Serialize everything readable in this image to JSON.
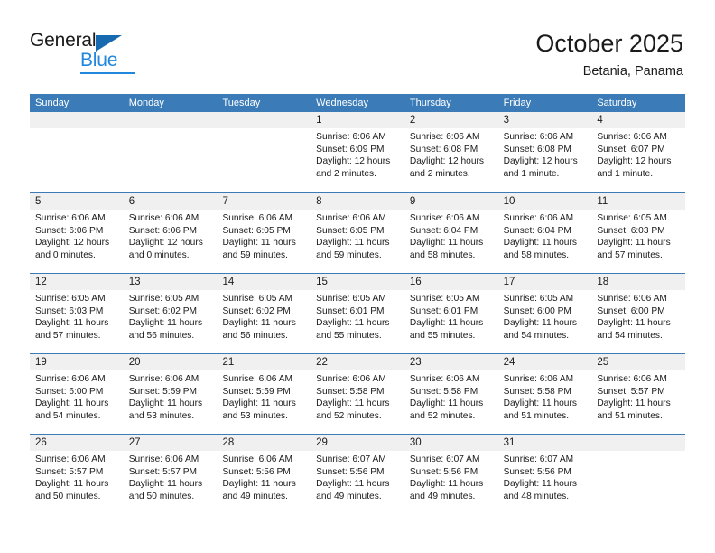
{
  "brand": {
    "name_top": "General",
    "name_bottom": "Blue",
    "color_primary": "#2288dd",
    "color_triangle": "#1769b0"
  },
  "header": {
    "title": "October 2025",
    "subtitle": "Betania, Panama"
  },
  "theme": {
    "header_row_bg": "#3b7cb8",
    "daynum_band_bg": "#f0f0f0",
    "cell_bg": "#ffffff",
    "text": "#1a1a1a"
  },
  "calendar": {
    "weekday_headers": [
      "Sunday",
      "Monday",
      "Tuesday",
      "Wednesday",
      "Thursday",
      "Friday",
      "Saturday"
    ],
    "weeks": [
      [
        {
          "day": "",
          "empty": true
        },
        {
          "day": "",
          "empty": true
        },
        {
          "day": "",
          "empty": true
        },
        {
          "day": "1",
          "sunrise": "Sunrise: 6:06 AM",
          "sunset": "Sunset: 6:09 PM",
          "daylight": "Daylight: 12 hours and 2 minutes."
        },
        {
          "day": "2",
          "sunrise": "Sunrise: 6:06 AM",
          "sunset": "Sunset: 6:08 PM",
          "daylight": "Daylight: 12 hours and 2 minutes."
        },
        {
          "day": "3",
          "sunrise": "Sunrise: 6:06 AM",
          "sunset": "Sunset: 6:08 PM",
          "daylight": "Daylight: 12 hours and 1 minute."
        },
        {
          "day": "4",
          "sunrise": "Sunrise: 6:06 AM",
          "sunset": "Sunset: 6:07 PM",
          "daylight": "Daylight: 12 hours and 1 minute."
        }
      ],
      [
        {
          "day": "5",
          "sunrise": "Sunrise: 6:06 AM",
          "sunset": "Sunset: 6:06 PM",
          "daylight": "Daylight: 12 hours and 0 minutes."
        },
        {
          "day": "6",
          "sunrise": "Sunrise: 6:06 AM",
          "sunset": "Sunset: 6:06 PM",
          "daylight": "Daylight: 12 hours and 0 minutes."
        },
        {
          "day": "7",
          "sunrise": "Sunrise: 6:06 AM",
          "sunset": "Sunset: 6:05 PM",
          "daylight": "Daylight: 11 hours and 59 minutes."
        },
        {
          "day": "8",
          "sunrise": "Sunrise: 6:06 AM",
          "sunset": "Sunset: 6:05 PM",
          "daylight": "Daylight: 11 hours and 59 minutes."
        },
        {
          "day": "9",
          "sunrise": "Sunrise: 6:06 AM",
          "sunset": "Sunset: 6:04 PM",
          "daylight": "Daylight: 11 hours and 58 minutes."
        },
        {
          "day": "10",
          "sunrise": "Sunrise: 6:06 AM",
          "sunset": "Sunset: 6:04 PM",
          "daylight": "Daylight: 11 hours and 58 minutes."
        },
        {
          "day": "11",
          "sunrise": "Sunrise: 6:05 AM",
          "sunset": "Sunset: 6:03 PM",
          "daylight": "Daylight: 11 hours and 57 minutes."
        }
      ],
      [
        {
          "day": "12",
          "sunrise": "Sunrise: 6:05 AM",
          "sunset": "Sunset: 6:03 PM",
          "daylight": "Daylight: 11 hours and 57 minutes."
        },
        {
          "day": "13",
          "sunrise": "Sunrise: 6:05 AM",
          "sunset": "Sunset: 6:02 PM",
          "daylight": "Daylight: 11 hours and 56 minutes."
        },
        {
          "day": "14",
          "sunrise": "Sunrise: 6:05 AM",
          "sunset": "Sunset: 6:02 PM",
          "daylight": "Daylight: 11 hours and 56 minutes."
        },
        {
          "day": "15",
          "sunrise": "Sunrise: 6:05 AM",
          "sunset": "Sunset: 6:01 PM",
          "daylight": "Daylight: 11 hours and 55 minutes."
        },
        {
          "day": "16",
          "sunrise": "Sunrise: 6:05 AM",
          "sunset": "Sunset: 6:01 PM",
          "daylight": "Daylight: 11 hours and 55 minutes."
        },
        {
          "day": "17",
          "sunrise": "Sunrise: 6:05 AM",
          "sunset": "Sunset: 6:00 PM",
          "daylight": "Daylight: 11 hours and 54 minutes."
        },
        {
          "day": "18",
          "sunrise": "Sunrise: 6:06 AM",
          "sunset": "Sunset: 6:00 PM",
          "daylight": "Daylight: 11 hours and 54 minutes."
        }
      ],
      [
        {
          "day": "19",
          "sunrise": "Sunrise: 6:06 AM",
          "sunset": "Sunset: 6:00 PM",
          "daylight": "Daylight: 11 hours and 54 minutes."
        },
        {
          "day": "20",
          "sunrise": "Sunrise: 6:06 AM",
          "sunset": "Sunset: 5:59 PM",
          "daylight": "Daylight: 11 hours and 53 minutes."
        },
        {
          "day": "21",
          "sunrise": "Sunrise: 6:06 AM",
          "sunset": "Sunset: 5:59 PM",
          "daylight": "Daylight: 11 hours and 53 minutes."
        },
        {
          "day": "22",
          "sunrise": "Sunrise: 6:06 AM",
          "sunset": "Sunset: 5:58 PM",
          "daylight": "Daylight: 11 hours and 52 minutes."
        },
        {
          "day": "23",
          "sunrise": "Sunrise: 6:06 AM",
          "sunset": "Sunset: 5:58 PM",
          "daylight": "Daylight: 11 hours and 52 minutes."
        },
        {
          "day": "24",
          "sunrise": "Sunrise: 6:06 AM",
          "sunset": "Sunset: 5:58 PM",
          "daylight": "Daylight: 11 hours and 51 minutes."
        },
        {
          "day": "25",
          "sunrise": "Sunrise: 6:06 AM",
          "sunset": "Sunset: 5:57 PM",
          "daylight": "Daylight: 11 hours and 51 minutes."
        }
      ],
      [
        {
          "day": "26",
          "sunrise": "Sunrise: 6:06 AM",
          "sunset": "Sunset: 5:57 PM",
          "daylight": "Daylight: 11 hours and 50 minutes."
        },
        {
          "day": "27",
          "sunrise": "Sunrise: 6:06 AM",
          "sunset": "Sunset: 5:57 PM",
          "daylight": "Daylight: 11 hours and 50 minutes."
        },
        {
          "day": "28",
          "sunrise": "Sunrise: 6:06 AM",
          "sunset": "Sunset: 5:56 PM",
          "daylight": "Daylight: 11 hours and 49 minutes."
        },
        {
          "day": "29",
          "sunrise": "Sunrise: 6:07 AM",
          "sunset": "Sunset: 5:56 PM",
          "daylight": "Daylight: 11 hours and 49 minutes."
        },
        {
          "day": "30",
          "sunrise": "Sunrise: 6:07 AM",
          "sunset": "Sunset: 5:56 PM",
          "daylight": "Daylight: 11 hours and 49 minutes."
        },
        {
          "day": "31",
          "sunrise": "Sunrise: 6:07 AM",
          "sunset": "Sunset: 5:56 PM",
          "daylight": "Daylight: 11 hours and 48 minutes."
        },
        {
          "day": "",
          "empty": true
        }
      ]
    ]
  }
}
